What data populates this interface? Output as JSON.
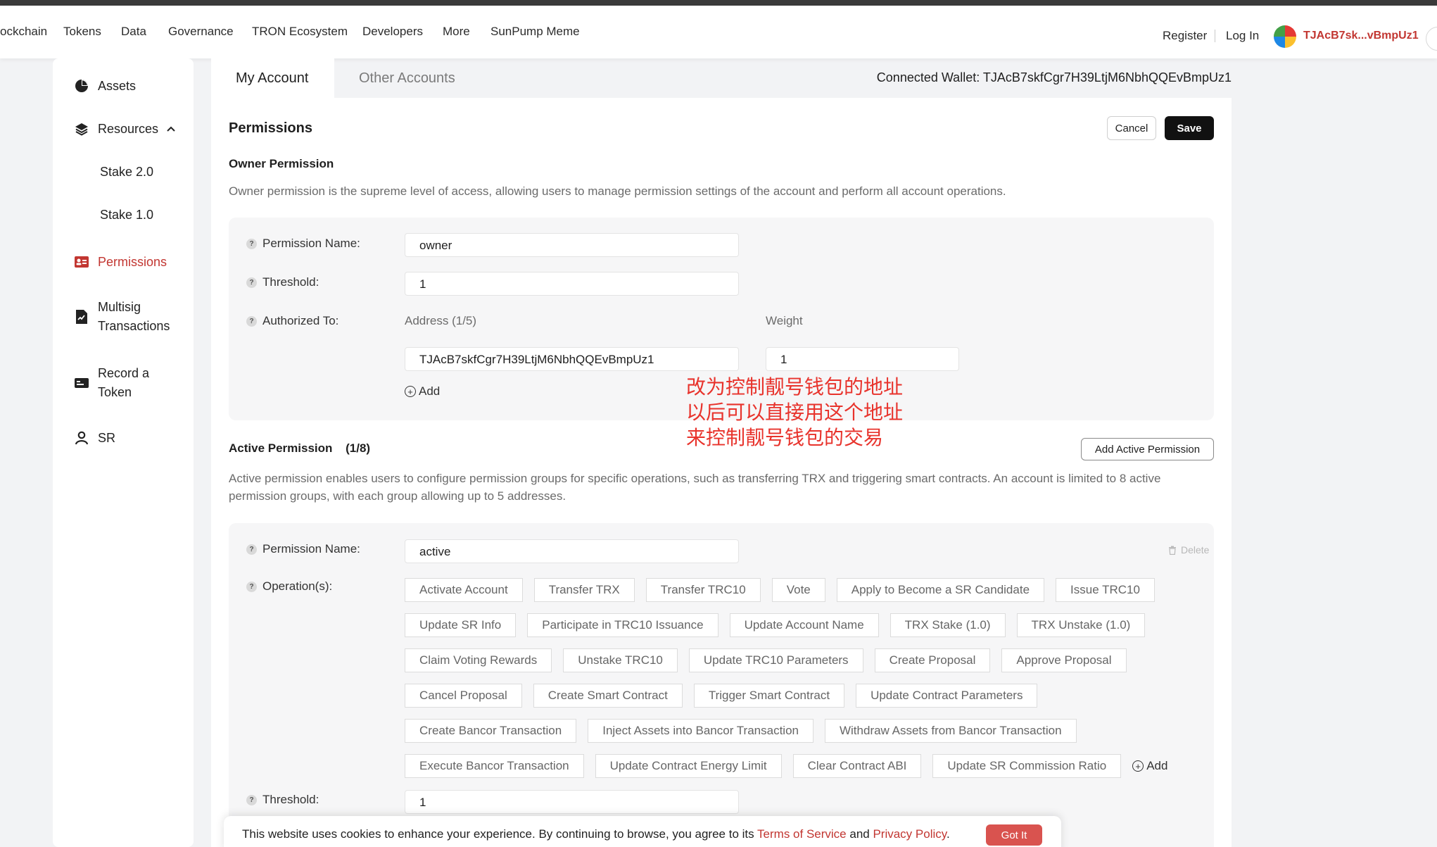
{
  "nav": {
    "items": [
      "ockchain",
      "Tokens",
      "Data",
      "Governance",
      "TRON Ecosystem",
      "Developers",
      "More",
      "SunPump Meme"
    ],
    "register": "Register",
    "login": "Log In",
    "wallet_short": "TJAcB7sk...vBmpUz1"
  },
  "sidebar": {
    "assets": "Assets",
    "resources": "Resources",
    "stake2": "Stake 2.0",
    "stake1": "Stake 1.0",
    "permissions": "Permissions",
    "multisig_1": "Multisig",
    "multisig_2": "Transactions",
    "record_1": "Record a",
    "record_2": "Token",
    "sr": "SR"
  },
  "tabs": {
    "my_account": "My Account",
    "other_accounts": "Other Accounts",
    "connected_wallet": "Connected Wallet: TJAcB7skfCgr7H39LtjM6NbhQQEvBmpUz1"
  },
  "permissions": {
    "title": "Permissions",
    "cancel": "Cancel",
    "save": "Save",
    "owner_title": "Owner Permission",
    "owner_desc": "Owner permission is the supreme level of access, allowing users to manage permission settings of the account and perform all account operations.",
    "owner": {
      "name_label": "Permission Name:",
      "name_value": "owner",
      "threshold_label": "Threshold:",
      "threshold_value": "1",
      "authorized_label": "Authorized To:",
      "address_header": "Address (1/5)",
      "weight_header": "Weight",
      "address_value": "TJAcB7skfCgr7H39LtjM6NbhQQEvBmpUz1",
      "weight_value": "1",
      "add": "Add"
    },
    "annotation": [
      "改为控制靓号钱包的地址",
      "以后可以直接用这个地址",
      "来控制靓号钱包的交易"
    ],
    "active_title": "Active Permission",
    "active_count": "(1/8)",
    "add_active": "Add Active Permission",
    "active_desc_1": "Active permission enables users to configure permission groups for specific operations, such as transferring TRX and triggering smart contracts. An account is limited to 8 active",
    "active_desc_2": "permission groups, with each group allowing up to 5 addresses.",
    "active": {
      "name_label": "Permission Name:",
      "name_value": "active",
      "delete": "Delete",
      "ops_label": "Operation(s):",
      "op_rows": [
        [
          "Activate Account",
          "Transfer TRX",
          "Transfer TRC10",
          "Vote",
          "Apply to Become a SR Candidate",
          "Issue TRC10"
        ],
        [
          "Update SR Info",
          "Participate in TRC10 Issuance",
          "Update Account Name",
          "TRX Stake (1.0)",
          "TRX Unstake (1.0)"
        ],
        [
          "Claim Voting Rewards",
          "Unstake TRC10",
          "Update TRC10 Parameters",
          "Create Proposal",
          "Approve Proposal"
        ],
        [
          "Cancel Proposal",
          "Create Smart Contract",
          "Trigger Smart Contract",
          "Update Contract Parameters"
        ],
        [
          "Create Bancor Transaction",
          "Inject Assets into Bancor Transaction",
          "Withdraw Assets from Bancor Transaction"
        ],
        [
          "Execute Bancor Transaction",
          "Update Contract Energy Limit",
          "Clear Contract ABI",
          "Update SR Commission Ratio"
        ]
      ],
      "ops_add": "Add",
      "threshold_label": "Threshold:",
      "threshold_value": "1"
    }
  },
  "cookie": {
    "text_1": "This website uses cookies to enhance your experience. By continuing to browse, you agree to its ",
    "terms": "Terms of Service",
    "and": " and ",
    "privacy": "Privacy Policy",
    "period": ".",
    "button": "Got It"
  },
  "colors": {
    "accent": "#c23631",
    "annotation": "#e8332c",
    "save_bg": "#111111"
  }
}
